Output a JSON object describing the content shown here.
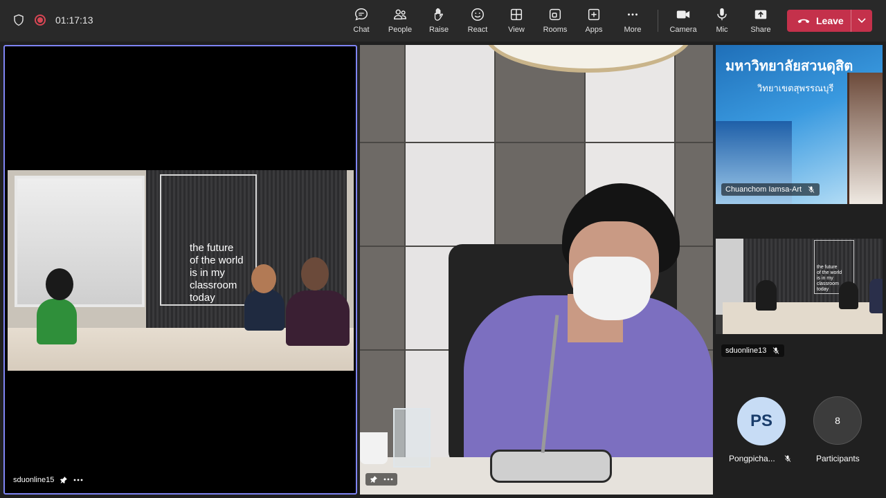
{
  "meeting": {
    "timer": "01:17:13"
  },
  "toolbar": {
    "items": [
      {
        "label": "Chat",
        "icon": "chat-icon"
      },
      {
        "label": "People",
        "icon": "people-icon"
      },
      {
        "label": "Raise",
        "icon": "raise-hand-icon"
      },
      {
        "label": "React",
        "icon": "react-icon"
      },
      {
        "label": "View",
        "icon": "view-icon"
      },
      {
        "label": "Rooms",
        "icon": "rooms-icon"
      },
      {
        "label": "Apps",
        "icon": "apps-icon"
      },
      {
        "label": "More",
        "icon": "more-icon"
      }
    ],
    "devices": [
      {
        "label": "Camera",
        "icon": "camera-icon"
      },
      {
        "label": "Mic",
        "icon": "mic-icon"
      },
      {
        "label": "Share",
        "icon": "share-icon"
      }
    ],
    "leave_label": "Leave"
  },
  "tiles": {
    "main": {
      "name": "sduonline15",
      "room_text": "the future\nof the world\nis in my\nclassroom\ntoday"
    },
    "speaker": {},
    "top_right": {
      "name": "Chuanchom Iamsa-Art",
      "banner_title": "มหาวิทยาลัยสวนดุสิต",
      "banner_sub": "วิทยาเขตสุพรรณบุรี"
    },
    "room2": {
      "name": "sduonline13",
      "room_text": "the future\nof the world\nis in my\nclassroom\ntoday"
    },
    "avatar": {
      "initials": "PS",
      "name": "Pongpicha..."
    },
    "participants": {
      "count": "8",
      "label": "Participants"
    }
  },
  "colors": {
    "accent": "#7f85f5",
    "leave": "#c4314b",
    "bg": "#202020",
    "topbar": "#292929"
  }
}
